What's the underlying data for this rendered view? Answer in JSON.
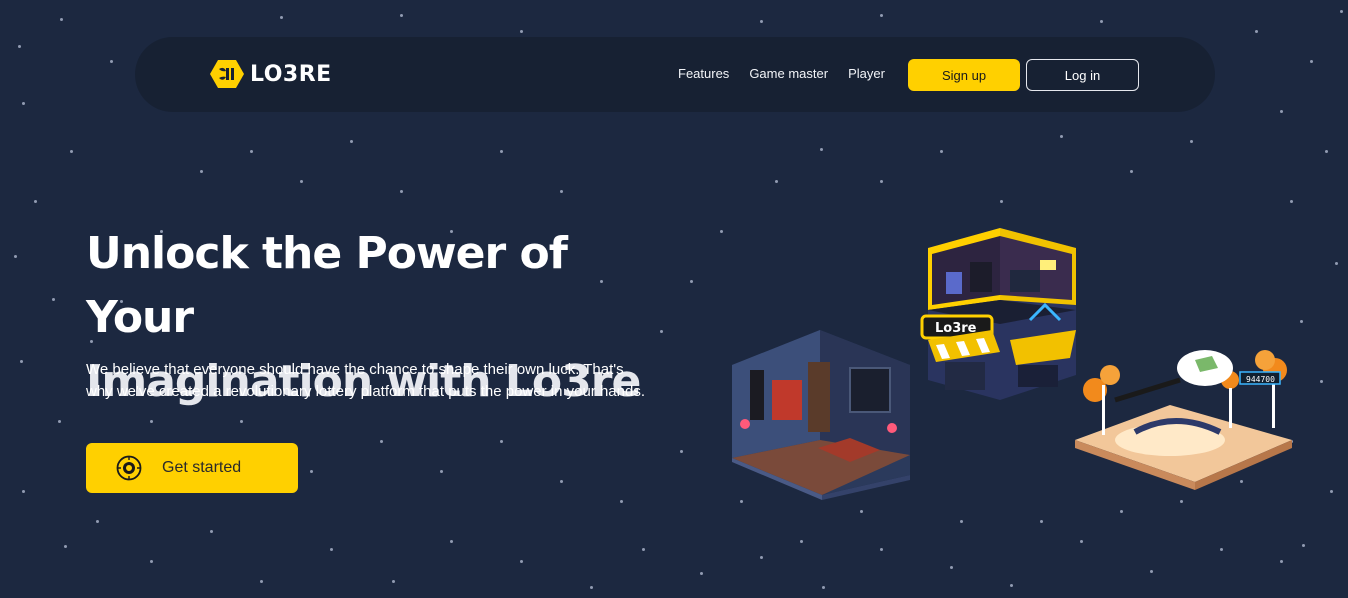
{
  "brand": {
    "name": "LO3RE",
    "logo_icon": "bee-hexagon-logo-icon"
  },
  "nav": {
    "links": [
      "Features",
      "Game master",
      "Player"
    ],
    "signup_label": "Sign up",
    "login_label": "Log in"
  },
  "hero": {
    "title_line1": "Unlock the Power of Your",
    "title_line2": "Imagination with Lo3re",
    "description": "We believe that everyone should have the chance to shape their own luck. That's why we've created a revolutionary lottery platform that puts the power in your hands.",
    "cta_label": "Get started",
    "cta_icon": "coin-icon"
  },
  "illustration": {
    "shop_sign": "Lo3re",
    "score_badge": "944700"
  },
  "colors": {
    "background": "#1c2840",
    "navbar": "#172133",
    "accent": "#ffd000",
    "text": "#ffffff"
  }
}
